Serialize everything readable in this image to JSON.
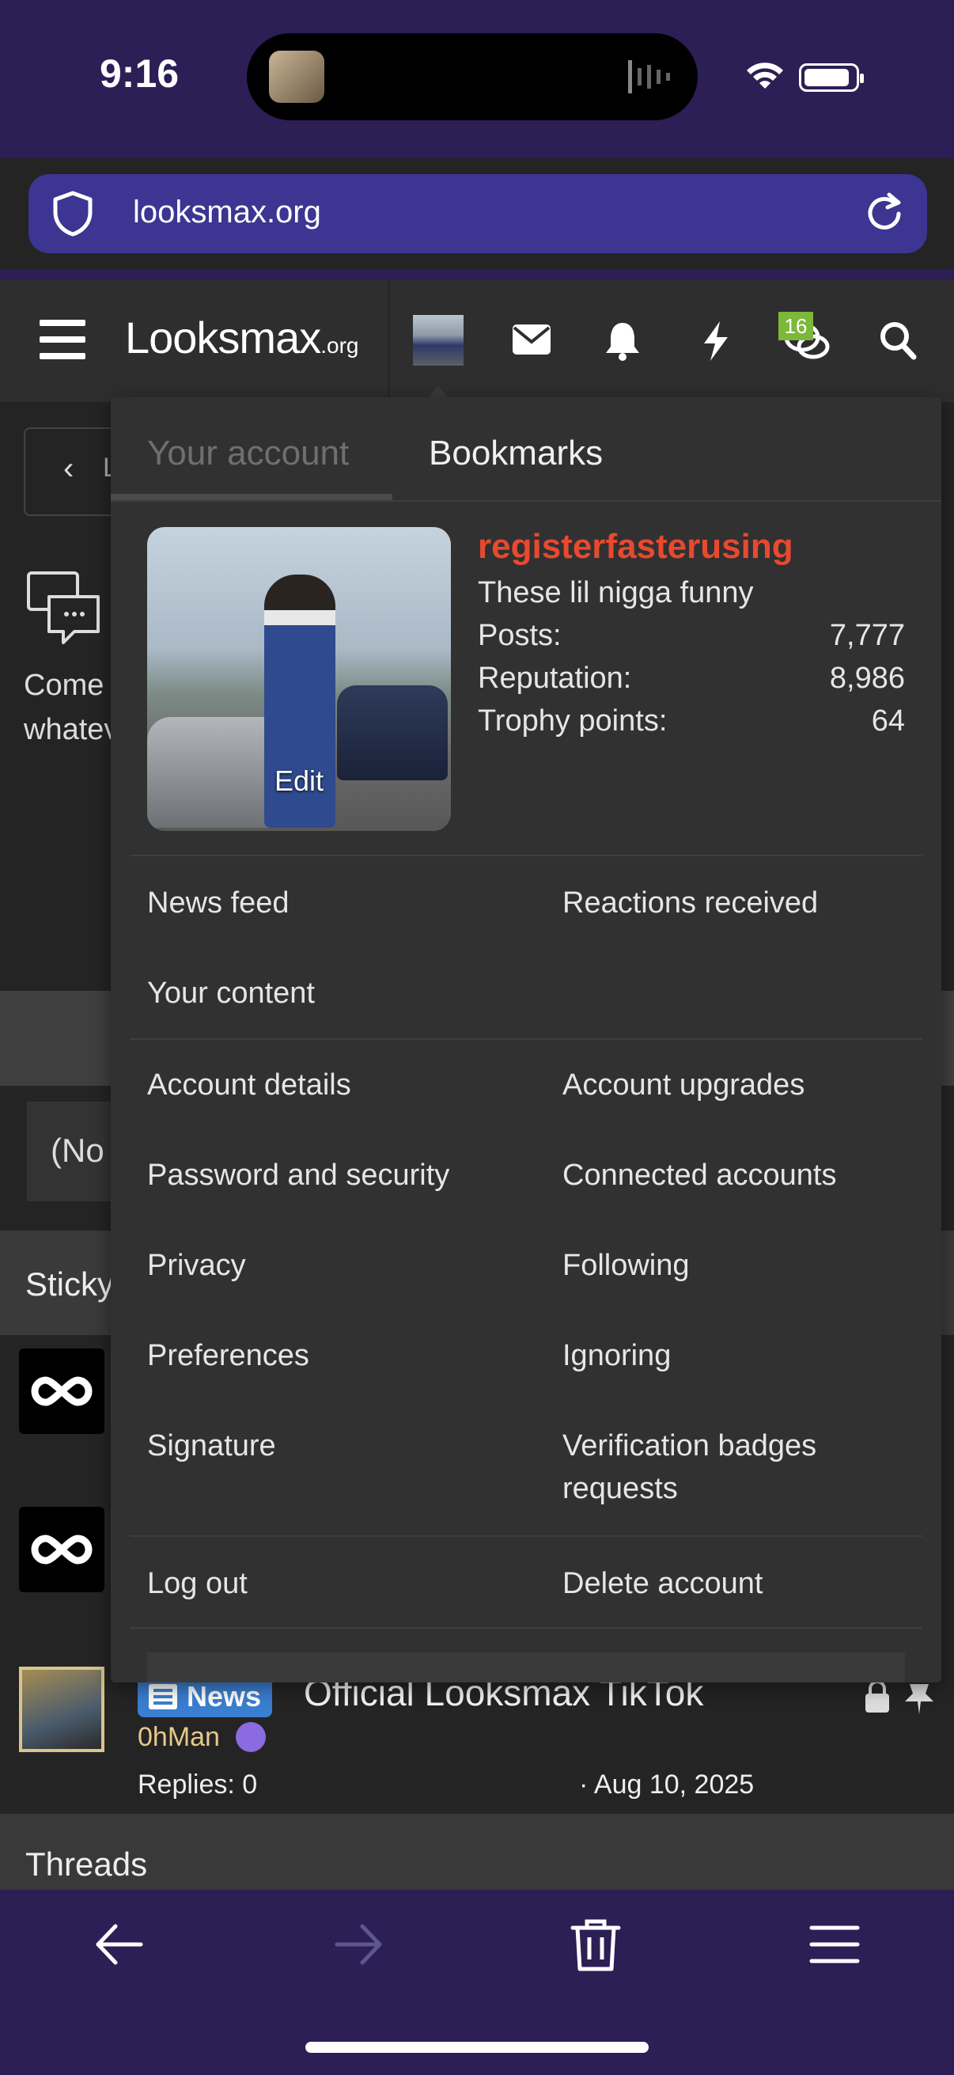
{
  "status_bar": {
    "time": "9:16"
  },
  "browser": {
    "url": "looksmax.org"
  },
  "site_header": {
    "logo": "Looksmax",
    "logo_suffix": ".org",
    "conversations_badge": "16"
  },
  "background_page": {
    "back_label": "L",
    "forum_desc": "Come\nwhatev",
    "prefix_filter": "(No",
    "sticky_header": "Sticky",
    "thread": {
      "tag": "News",
      "title": "Official Looksmax TikTok",
      "author": "0hMan",
      "replies": "Replies: 0",
      "date": "· Aug 10, 2025"
    },
    "threads_header": "Threads"
  },
  "account_menu": {
    "tabs": [
      "Your account",
      "Bookmarks"
    ],
    "profile": {
      "username": "registerfasterusing",
      "user_title": "These lil nigga funny",
      "edit_label": "Edit",
      "stats": [
        {
          "label": "Posts:",
          "value": "7,777"
        },
        {
          "label": "Reputation:",
          "value": "8,986"
        },
        {
          "label": "Trophy points:",
          "value": "64"
        }
      ]
    },
    "groups": {
      "activity": [
        "News feed",
        "Reactions received",
        "Your content"
      ],
      "settings": [
        "Account details",
        "Account upgrades",
        "Password and security",
        "Connected accounts",
        "Privacy",
        "Following",
        "Preferences",
        "Ignoring",
        "Signature",
        "Verification badges requests"
      ],
      "session": [
        "Log out",
        "Delete account"
      ]
    }
  },
  "colors": {
    "accent_name": "#e8492f",
    "browser_bar": "#2b1f55",
    "url_field": "#3c3591",
    "badge": "#7cb83a"
  }
}
